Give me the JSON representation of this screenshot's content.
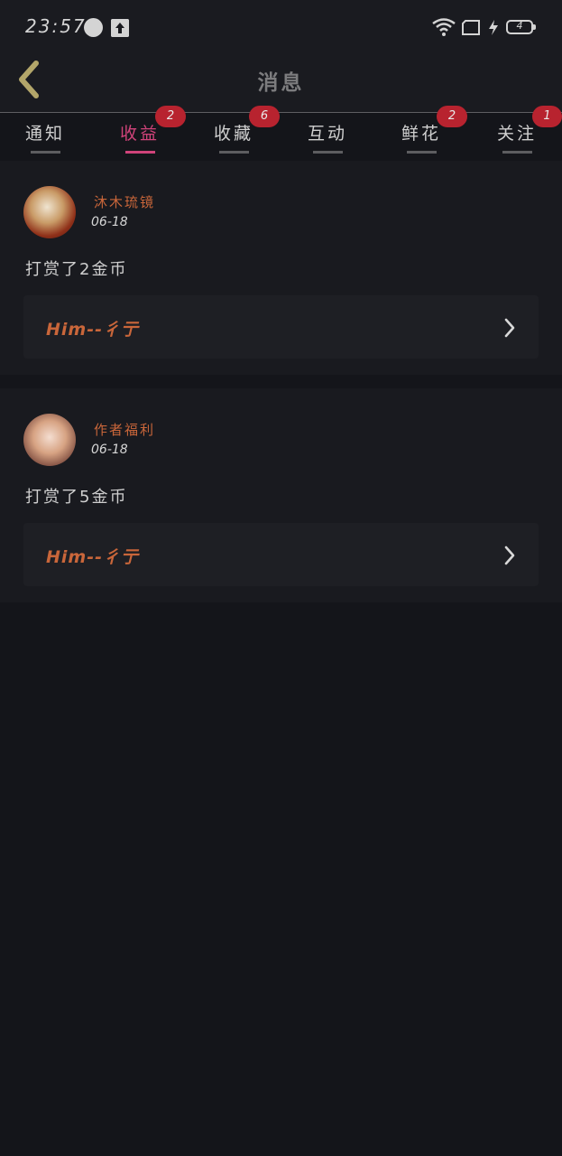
{
  "status_bar": {
    "time": "23:57",
    "battery_level": "4",
    "icons": [
      "account-circle-icon",
      "upload-icon",
      "wifi-icon",
      "sim-card-icon",
      "charging-icon",
      "battery-icon"
    ]
  },
  "header": {
    "title": "消息",
    "back_icon": "chevron-left-icon"
  },
  "tabs": [
    {
      "label": "通知",
      "badge": "",
      "active": false
    },
    {
      "label": "收益",
      "badge": "2",
      "active": true
    },
    {
      "label": "收藏",
      "badge": "6",
      "active": false
    },
    {
      "label": "互动",
      "badge": "",
      "active": false
    },
    {
      "label": "鲜花",
      "badge": "2",
      "active": false
    },
    {
      "label": "关注",
      "badge": "1",
      "active": false
    }
  ],
  "messages": [
    {
      "sender": "沐木琉镜",
      "date": "06-18",
      "text": "打赏了2金币",
      "link_text": "Him--彳亍",
      "avatar_icon": "avatar-image"
    },
    {
      "sender": "作者福利",
      "date": "06-18",
      "text": "打赏了5金币",
      "link_text": "Him--彳亍",
      "avatar_icon": "avatar-image"
    }
  ],
  "colors": {
    "background": "#14151a",
    "active_tab": "#d0437a",
    "badge": "#b8232f",
    "accent_text": "#c9663a",
    "back_arrow": "#b3a66a"
  }
}
